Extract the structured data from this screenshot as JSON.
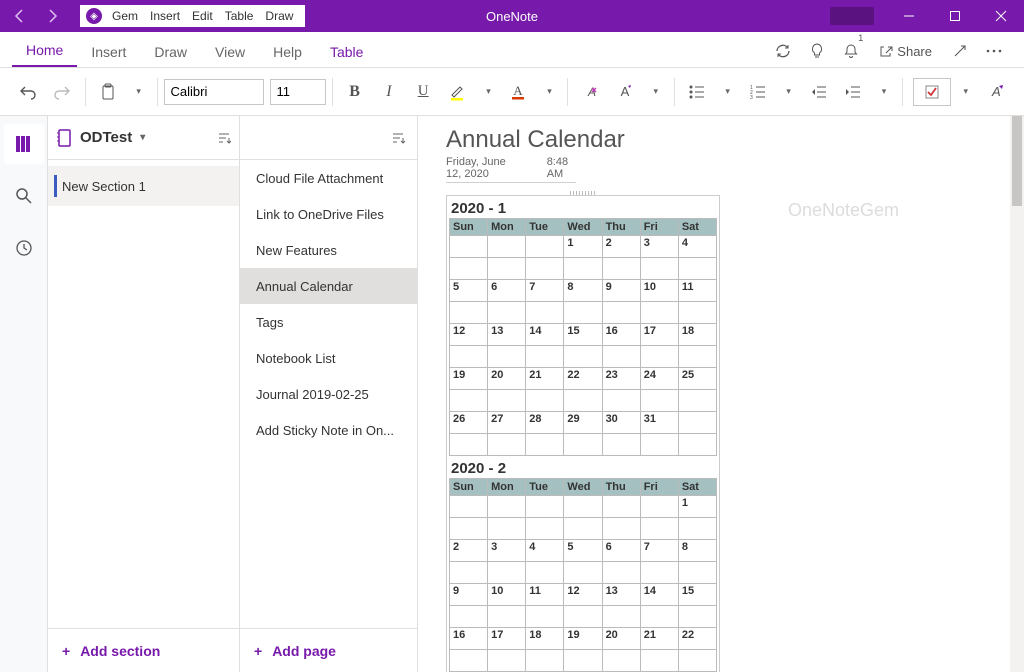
{
  "title_bar": {
    "app_name": "OneNote",
    "gem_menu": [
      "Gem",
      "Insert",
      "Edit",
      "Table",
      "Draw"
    ]
  },
  "ribbon": {
    "tabs": [
      "Home",
      "Insert",
      "Draw",
      "View",
      "Help",
      "Table"
    ],
    "active_tab": "Home",
    "share_label": "Share"
  },
  "toolbar": {
    "font_name": "Calibri",
    "font_size": "11"
  },
  "notebook": {
    "name": "ODTest"
  },
  "sections": {
    "items": [
      "New Section 1"
    ],
    "add_label": "Add section"
  },
  "pages": {
    "items": [
      "Cloud File Attachment",
      "Link to OneDrive Files",
      "New Features",
      "Annual Calendar",
      "Tags",
      "Notebook List",
      "Journal 2019-02-25",
      "Add Sticky Note in On..."
    ],
    "selected_index": 3,
    "add_label": "Add page"
  },
  "page": {
    "title": "Annual Calendar",
    "date": "Friday, June 12, 2020",
    "time": "8:48 AM"
  },
  "watermark": "OneNoteGem",
  "calendar": {
    "day_headers": [
      "Sun",
      "Mon",
      "Tue",
      "Wed",
      "Thu",
      "Fri",
      "Sat"
    ],
    "months": [
      {
        "title": "2020 - 1",
        "weeks": [
          [
            "",
            "",
            "",
            "1",
            "2",
            "3",
            "4"
          ],
          [
            "5",
            "6",
            "7",
            "8",
            "9",
            "10",
            "11"
          ],
          [
            "12",
            "13",
            "14",
            "15",
            "16",
            "17",
            "18"
          ],
          [
            "19",
            "20",
            "21",
            "22",
            "23",
            "24",
            "25"
          ],
          [
            "26",
            "27",
            "28",
            "29",
            "30",
            "31",
            ""
          ]
        ]
      },
      {
        "title": "2020 - 2",
        "weeks": [
          [
            "",
            "",
            "",
            "",
            "",
            "",
            "1"
          ],
          [
            "2",
            "3",
            "4",
            "5",
            "6",
            "7",
            "8"
          ],
          [
            "9",
            "10",
            "11",
            "12",
            "13",
            "14",
            "15"
          ],
          [
            "16",
            "17",
            "18",
            "19",
            "20",
            "21",
            "22"
          ]
        ]
      }
    ]
  }
}
